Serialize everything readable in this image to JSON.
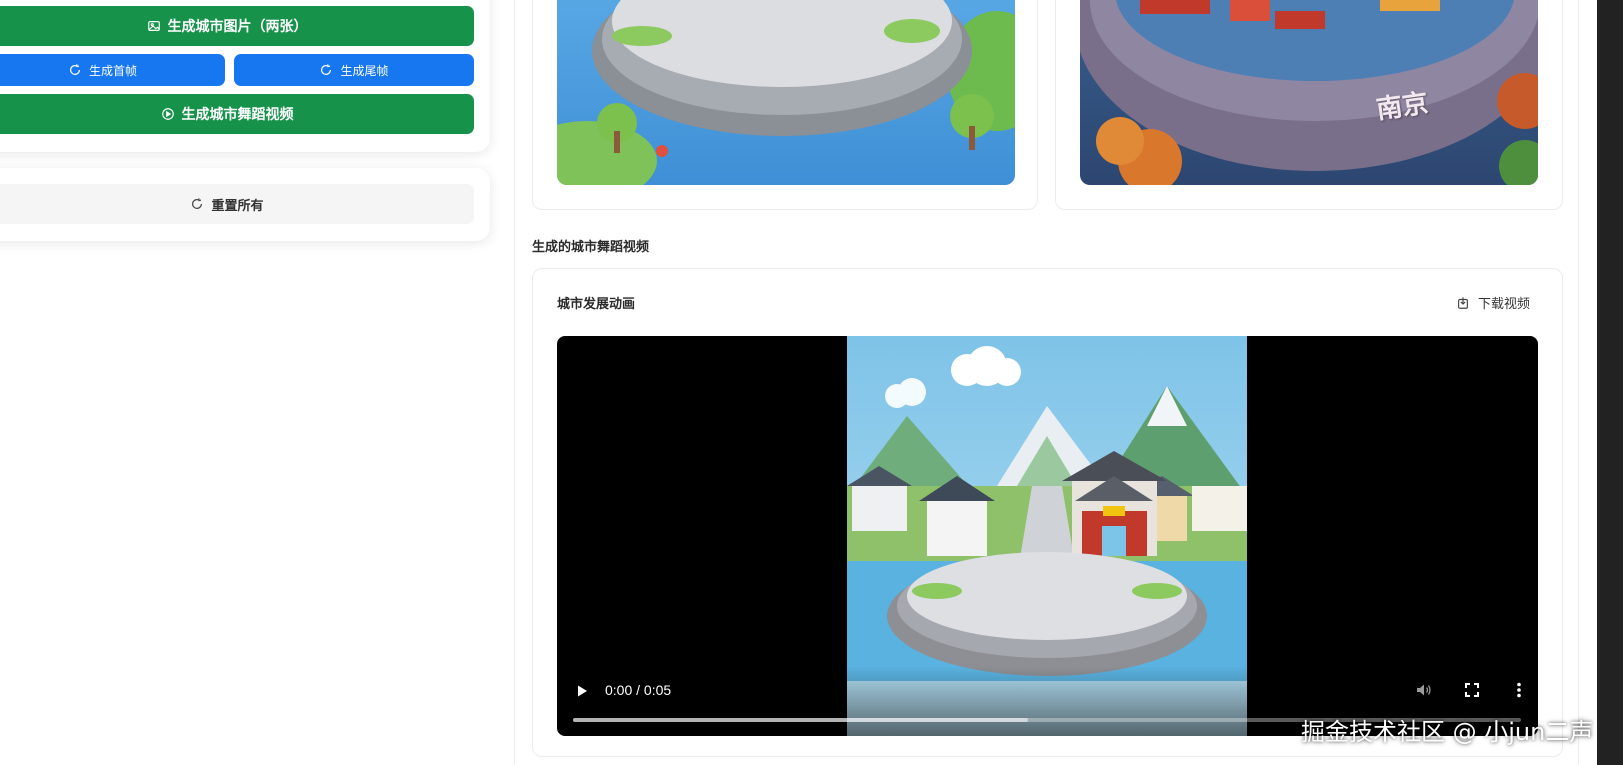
{
  "left_panel": {
    "gen_images_label": "生成城市图片（两张）",
    "gen_first_label": "生成首帧",
    "gen_last_label": "生成尾帧",
    "gen_video_label": "生成城市舞蹈视频",
    "reset_label": "重置所有"
  },
  "images": {
    "city_label": "南京"
  },
  "video_section": {
    "title": "生成的城市舞蹈视频",
    "card_title": "城市发展动画",
    "download_label": "下载视频",
    "time": "0:00 / 0:05",
    "progress": 0.48
  },
  "watermark": "掘金技术社区 @ 小jun二声",
  "colors": {
    "green": "#16924a",
    "blue": "#1677f0"
  }
}
